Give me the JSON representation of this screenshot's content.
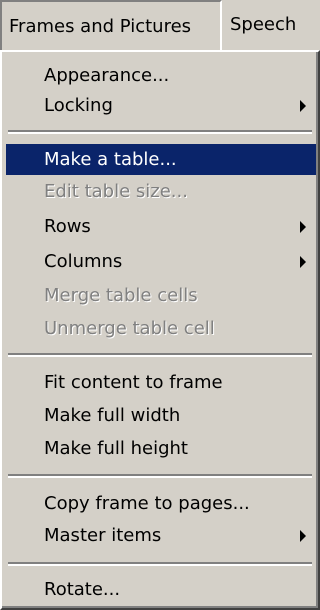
{
  "menubar": {
    "active_label": "Frames and Pictures",
    "other_label": "Speech"
  },
  "menu": {
    "items": [
      {
        "label": "Appearance..."
      },
      {
        "label": "Locking",
        "submenu": true
      },
      {
        "label": "Make a table...",
        "selected": true
      },
      {
        "label": "Edit table size...",
        "disabled": true
      },
      {
        "label": "Rows",
        "submenu": true
      },
      {
        "label": "Columns",
        "submenu": true
      },
      {
        "label": "Merge table cells",
        "disabled": true
      },
      {
        "label": "Unmerge table cell",
        "disabled": true
      },
      {
        "label": "Fit content to frame"
      },
      {
        "label": "Make full width"
      },
      {
        "label": "Make full height"
      },
      {
        "label": "Copy frame to pages..."
      },
      {
        "label": "Master items",
        "submenu": true
      },
      {
        "label": "Rotate..."
      }
    ]
  },
  "colors": {
    "menu_background": "#d4d0c8",
    "selection_background": "#0a246a",
    "selection_text": "#ffffff",
    "disabled_text": "#808080"
  }
}
